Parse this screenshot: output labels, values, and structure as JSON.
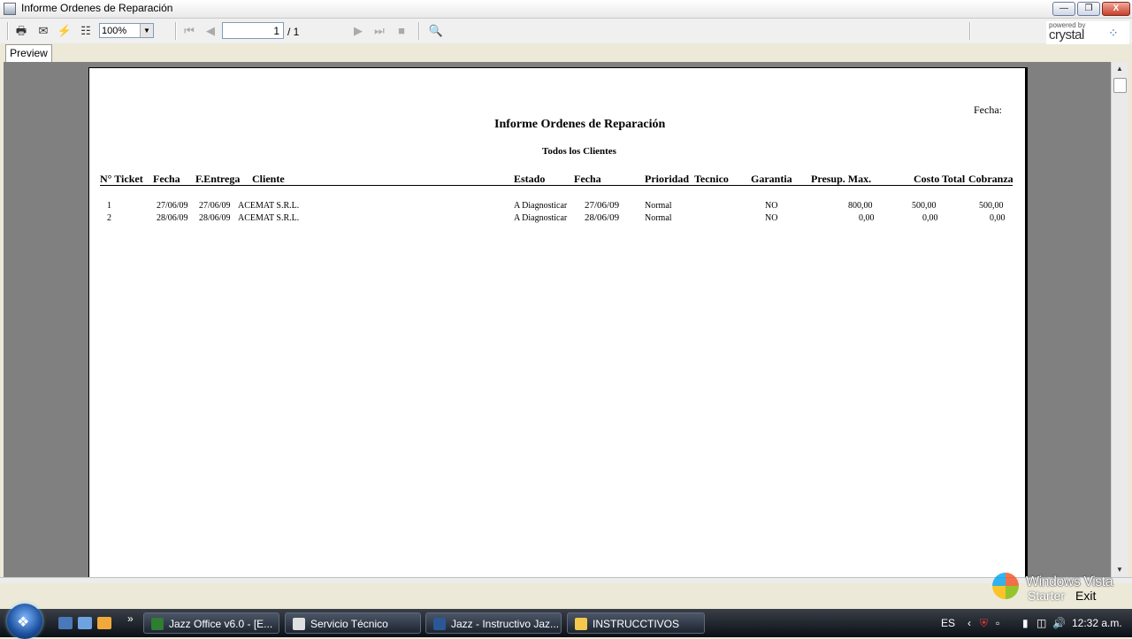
{
  "window": {
    "title": "Informe Ordenes de Reparación",
    "min": "—",
    "max": "❐",
    "close": "X"
  },
  "toolbar": {
    "zoom": "100%",
    "page_current": "1",
    "page_total": "/ 1"
  },
  "brand": {
    "powered": "powered by",
    "name": "crystal"
  },
  "tabs": {
    "preview": "Preview"
  },
  "report": {
    "date_label": "Fecha:",
    "title": "Informe Ordenes de Reparación",
    "subtitle": "Todos los Clientes",
    "columns": {
      "ticket": "N° Ticket",
      "fecha": "Fecha",
      "fentrega": "F.Entrega",
      "cliente": "Cliente",
      "estado": "Estado",
      "fecha2": "Fecha",
      "prioridad": "Prioridad",
      "tecnico": "Tecnico",
      "garantia": "Garantia",
      "presup": "Presup. Max.",
      "costo": "Costo",
      "total": "Total",
      "cobranza": "Cobranza"
    },
    "rows": [
      {
        "ticket": "1",
        "fecha": "27/06/09",
        "fentrega": "27/06/09",
        "cliente": "ACEMAT S.R.L.",
        "estado": "A Diagnosticar",
        "fecha2": "27/06/09",
        "prioridad": "Normal",
        "garantia": "NO",
        "presup": "800,00",
        "costo": "500,00",
        "cobranza": "500,00"
      },
      {
        "ticket": "2",
        "fecha": "28/06/09",
        "fentrega": "28/06/09",
        "cliente": "ACEMAT S.R.L.",
        "estado": "A Diagnosticar",
        "fecha2": "28/06/09",
        "prioridad": "Normal",
        "garantia": "NO",
        "presup": "0,00",
        "costo": "0,00",
        "cobranza": "0,00"
      }
    ]
  },
  "taskbar": {
    "items": [
      {
        "label": "Jazz Office v6.0 - [E...",
        "color": "#2e7d32"
      },
      {
        "label": "Servicio Técnico",
        "color": "#e0e0e0"
      },
      {
        "label": "Jazz - Instructivo Jaz...",
        "color": "#2b5797"
      },
      {
        "label": "INSTRUCCTIVOS",
        "color": "#f2c94c"
      }
    ],
    "lang": "ES",
    "clock": "12:32 a.m.",
    "more": "»"
  },
  "watermark": {
    "line1": "Windows Vista",
    "line2": "Starter",
    "line3": "Exit"
  },
  "colors": {
    "taskbar": "#1d2430",
    "viewport": "#808080",
    "accent": "#2a6db5"
  }
}
